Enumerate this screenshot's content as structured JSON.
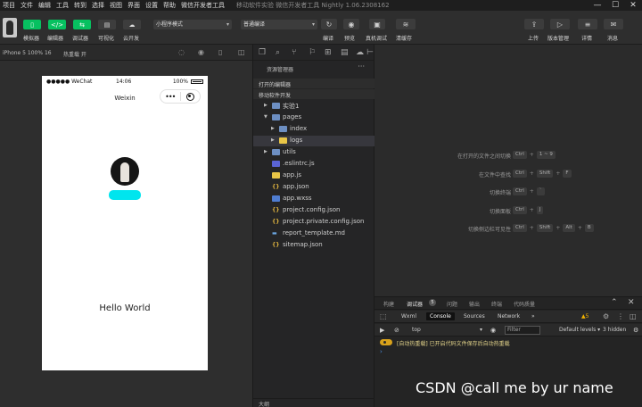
{
  "menubar": {
    "items": [
      "项目",
      "文件",
      "编辑",
      "工具",
      "转到",
      "选择",
      "视图",
      "界面",
      "设置",
      "帮助",
      "微信开发者工具"
    ],
    "title": "移动软件实验   微信开发者工具 Nightly 1.06.2308162",
    "min": "—",
    "max": "☐",
    "close": "✕"
  },
  "toolbar": {
    "simulator": "模拟器",
    "editor": "编辑器",
    "debugger": "调试器",
    "visual": "可视化",
    "cloud": "云开发",
    "simulator_icon": "▯",
    "editor_icon": "</>",
    "debugger_icon": "⇆",
    "visual_icon": "▤",
    "cloud_icon": "☁",
    "mode_select": "小程序模式",
    "compile_select": "普通编译",
    "compile": "编译",
    "preview": "预览",
    "real_debug": "真机调试",
    "clear_cache": "清缓存",
    "upload": "上传",
    "version": "版本管理",
    "details": "详情",
    "message": "消息",
    "refresh_icon": "↻",
    "eye_icon": "◉",
    "phone_icon": "▣",
    "layers_icon": "≋",
    "upload_icon": "⇪",
    "version_icon": "▷",
    "details_icon": "≡",
    "message_icon": "✉"
  },
  "simulator": {
    "device": "iPhone 5 100% 16",
    "hotreload": "热重载 开",
    "phone": {
      "carrier": "●●●●● WeChat",
      "time": "14:06",
      "battery": "100%",
      "nav_title": "Weixin",
      "menu_dots": "•••",
      "hello": "Hello World"
    }
  },
  "explorer": {
    "header": "资源管理器",
    "more": "···",
    "open_editors": "打开的编辑器",
    "project": "移动软件开发",
    "files": [
      {
        "name": "实验1",
        "type": "folder"
      },
      {
        "name": "pages",
        "type": "folder"
      },
      {
        "name": "index",
        "type": "folder"
      },
      {
        "name": "logs",
        "type": "folder-y"
      },
      {
        "name": "utils",
        "type": "folder"
      },
      {
        "name": ".eslintrc.js",
        "type": "rc"
      },
      {
        "name": "app.js",
        "type": "js"
      },
      {
        "name": "app.json",
        "type": "json"
      },
      {
        "name": "app.wxss",
        "type": "wxss"
      },
      {
        "name": "project.config.json",
        "type": "json"
      },
      {
        "name": "project.private.config.json",
        "type": "json"
      },
      {
        "name": "report_template.md",
        "type": "md"
      },
      {
        "name": "sitemap.json",
        "type": "json"
      }
    ],
    "outline": "大纲"
  },
  "editor": {
    "shortcuts": [
      {
        "label": "在打开的文件之间切换",
        "keys": [
          "Ctrl",
          "1 ~ 9"
        ]
      },
      {
        "label": "在文件中查找",
        "keys": [
          "Ctrl",
          "Shift",
          "F"
        ]
      },
      {
        "label": "切换终端",
        "keys": [
          "Ctrl",
          "`"
        ]
      },
      {
        "label": "切换面板",
        "keys": [
          "Ctrl",
          "J"
        ]
      },
      {
        "label": "切换侧边栏可见性",
        "keys": [
          "Ctrl",
          "Shift",
          "Alt",
          "B"
        ]
      }
    ]
  },
  "debugger": {
    "tabs": [
      "构建",
      "调试器",
      "问题",
      "输出",
      "终端",
      "代码质量"
    ],
    "badge": "5",
    "devtools_tabs": [
      "Wxml",
      "Console",
      "Sources",
      "Network",
      "»"
    ],
    "warn_count": "▲5",
    "context": "top",
    "filter_placeholder": "Filter",
    "levels": "Default levels ▾",
    "hidden": "3 hidden",
    "message": "[自动热重载] 已开启代码文件保存后自动热重载",
    "prompt": "›"
  },
  "watermark": "CSDN @call me by ur name"
}
